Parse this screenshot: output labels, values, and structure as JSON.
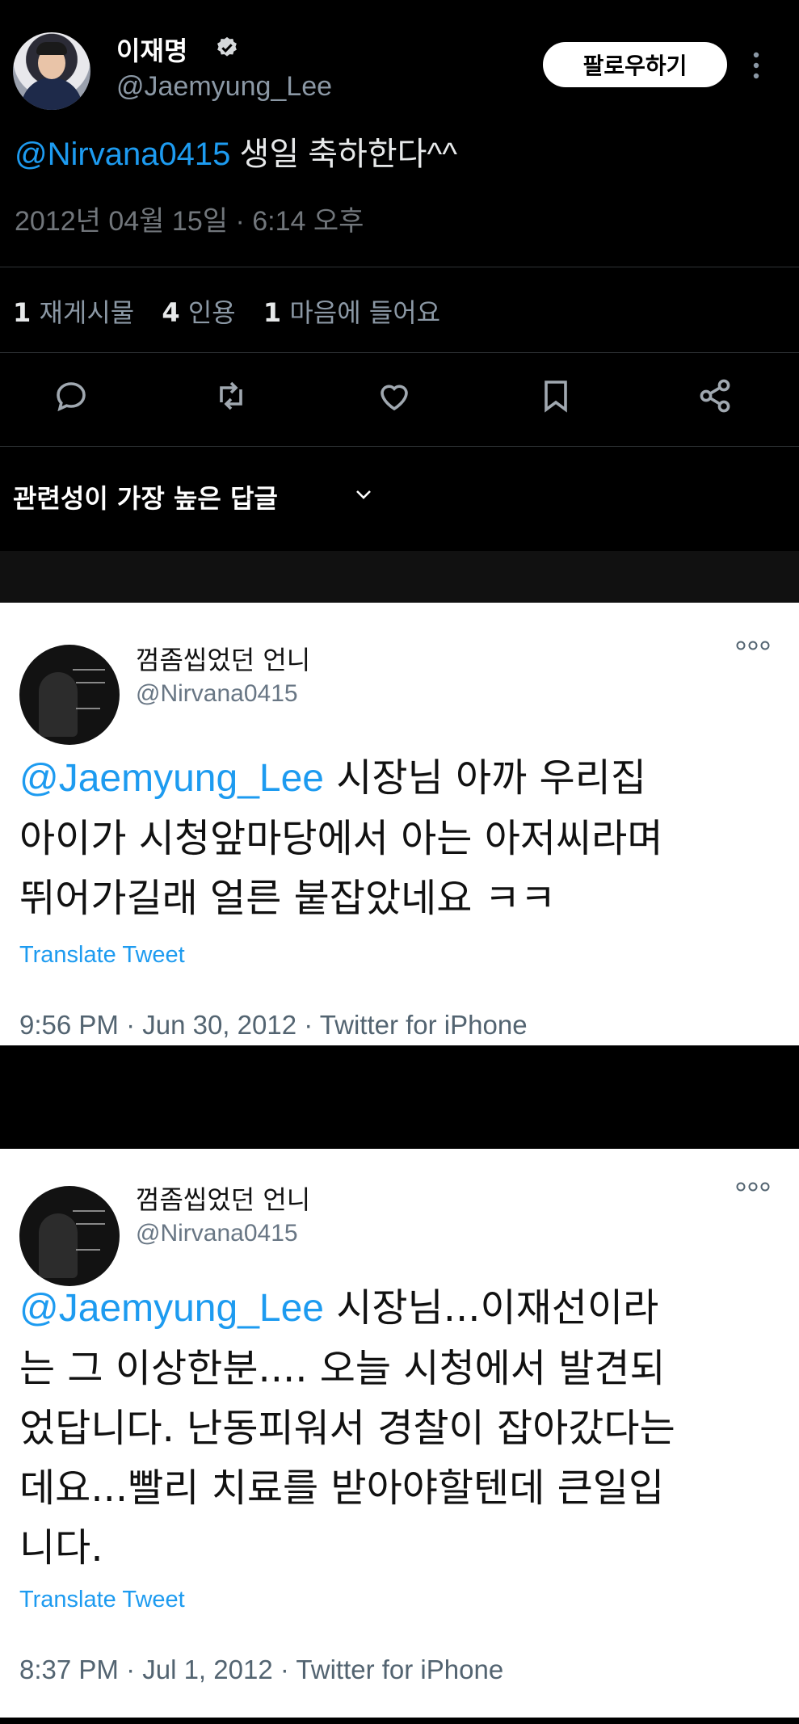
{
  "tweet": {
    "author_name": "이재명",
    "author_handle": "@Jaemyung_Lee",
    "follow_label": "팔로우하기",
    "mention": "@Nirvana0415",
    "text": " 생일  축하한다^^",
    "timestamp": "2012년 04월 15일 · 6:14 오후",
    "stats": [
      {
        "count": "1",
        "label": "재게시물"
      },
      {
        "count": "4",
        "label": "인용"
      },
      {
        "count": "1",
        "label": "마음에 들어요"
      }
    ],
    "replies_sort": "관련성이 가장 높은 답글",
    "colors": {
      "accent": "#1d9bf0",
      "background": "#000000"
    }
  },
  "replies": [
    {
      "author_name": "껌좀씹었던 언니",
      "author_handle": "@Nirvana0415",
      "mention": "@Jaemyung_Lee",
      "text_line1": " 시장님 아까 우리집",
      "text_line2": "아이가 시청앞마당에서 아는 아저씨라며",
      "text_line3": "뛰어가길래 얼른 붙잡았네요 ㅋㅋ",
      "translate": "Translate Tweet",
      "meta": "9:56 PM · Jun 30, 2012 · Twitter for iPhone"
    },
    {
      "author_name": "껌좀씹었던 언니",
      "author_handle": "@Nirvana0415",
      "mention": "@Jaemyung_Lee",
      "text_line1": " 시장님...이재선이라",
      "text_line2": "는 그 이상한분.... 오늘 시청에서 발견되",
      "text_line3": "었답니다. 난동피워서 경찰이 잡아갔다는",
      "text_line4": "데요...빨리 치료를 받아야할텐데 큰일입",
      "text_line5": "니다.",
      "translate": "Translate Tweet",
      "meta": "8:37 PM · Jul 1, 2012 · Twitter for iPhone"
    }
  ]
}
